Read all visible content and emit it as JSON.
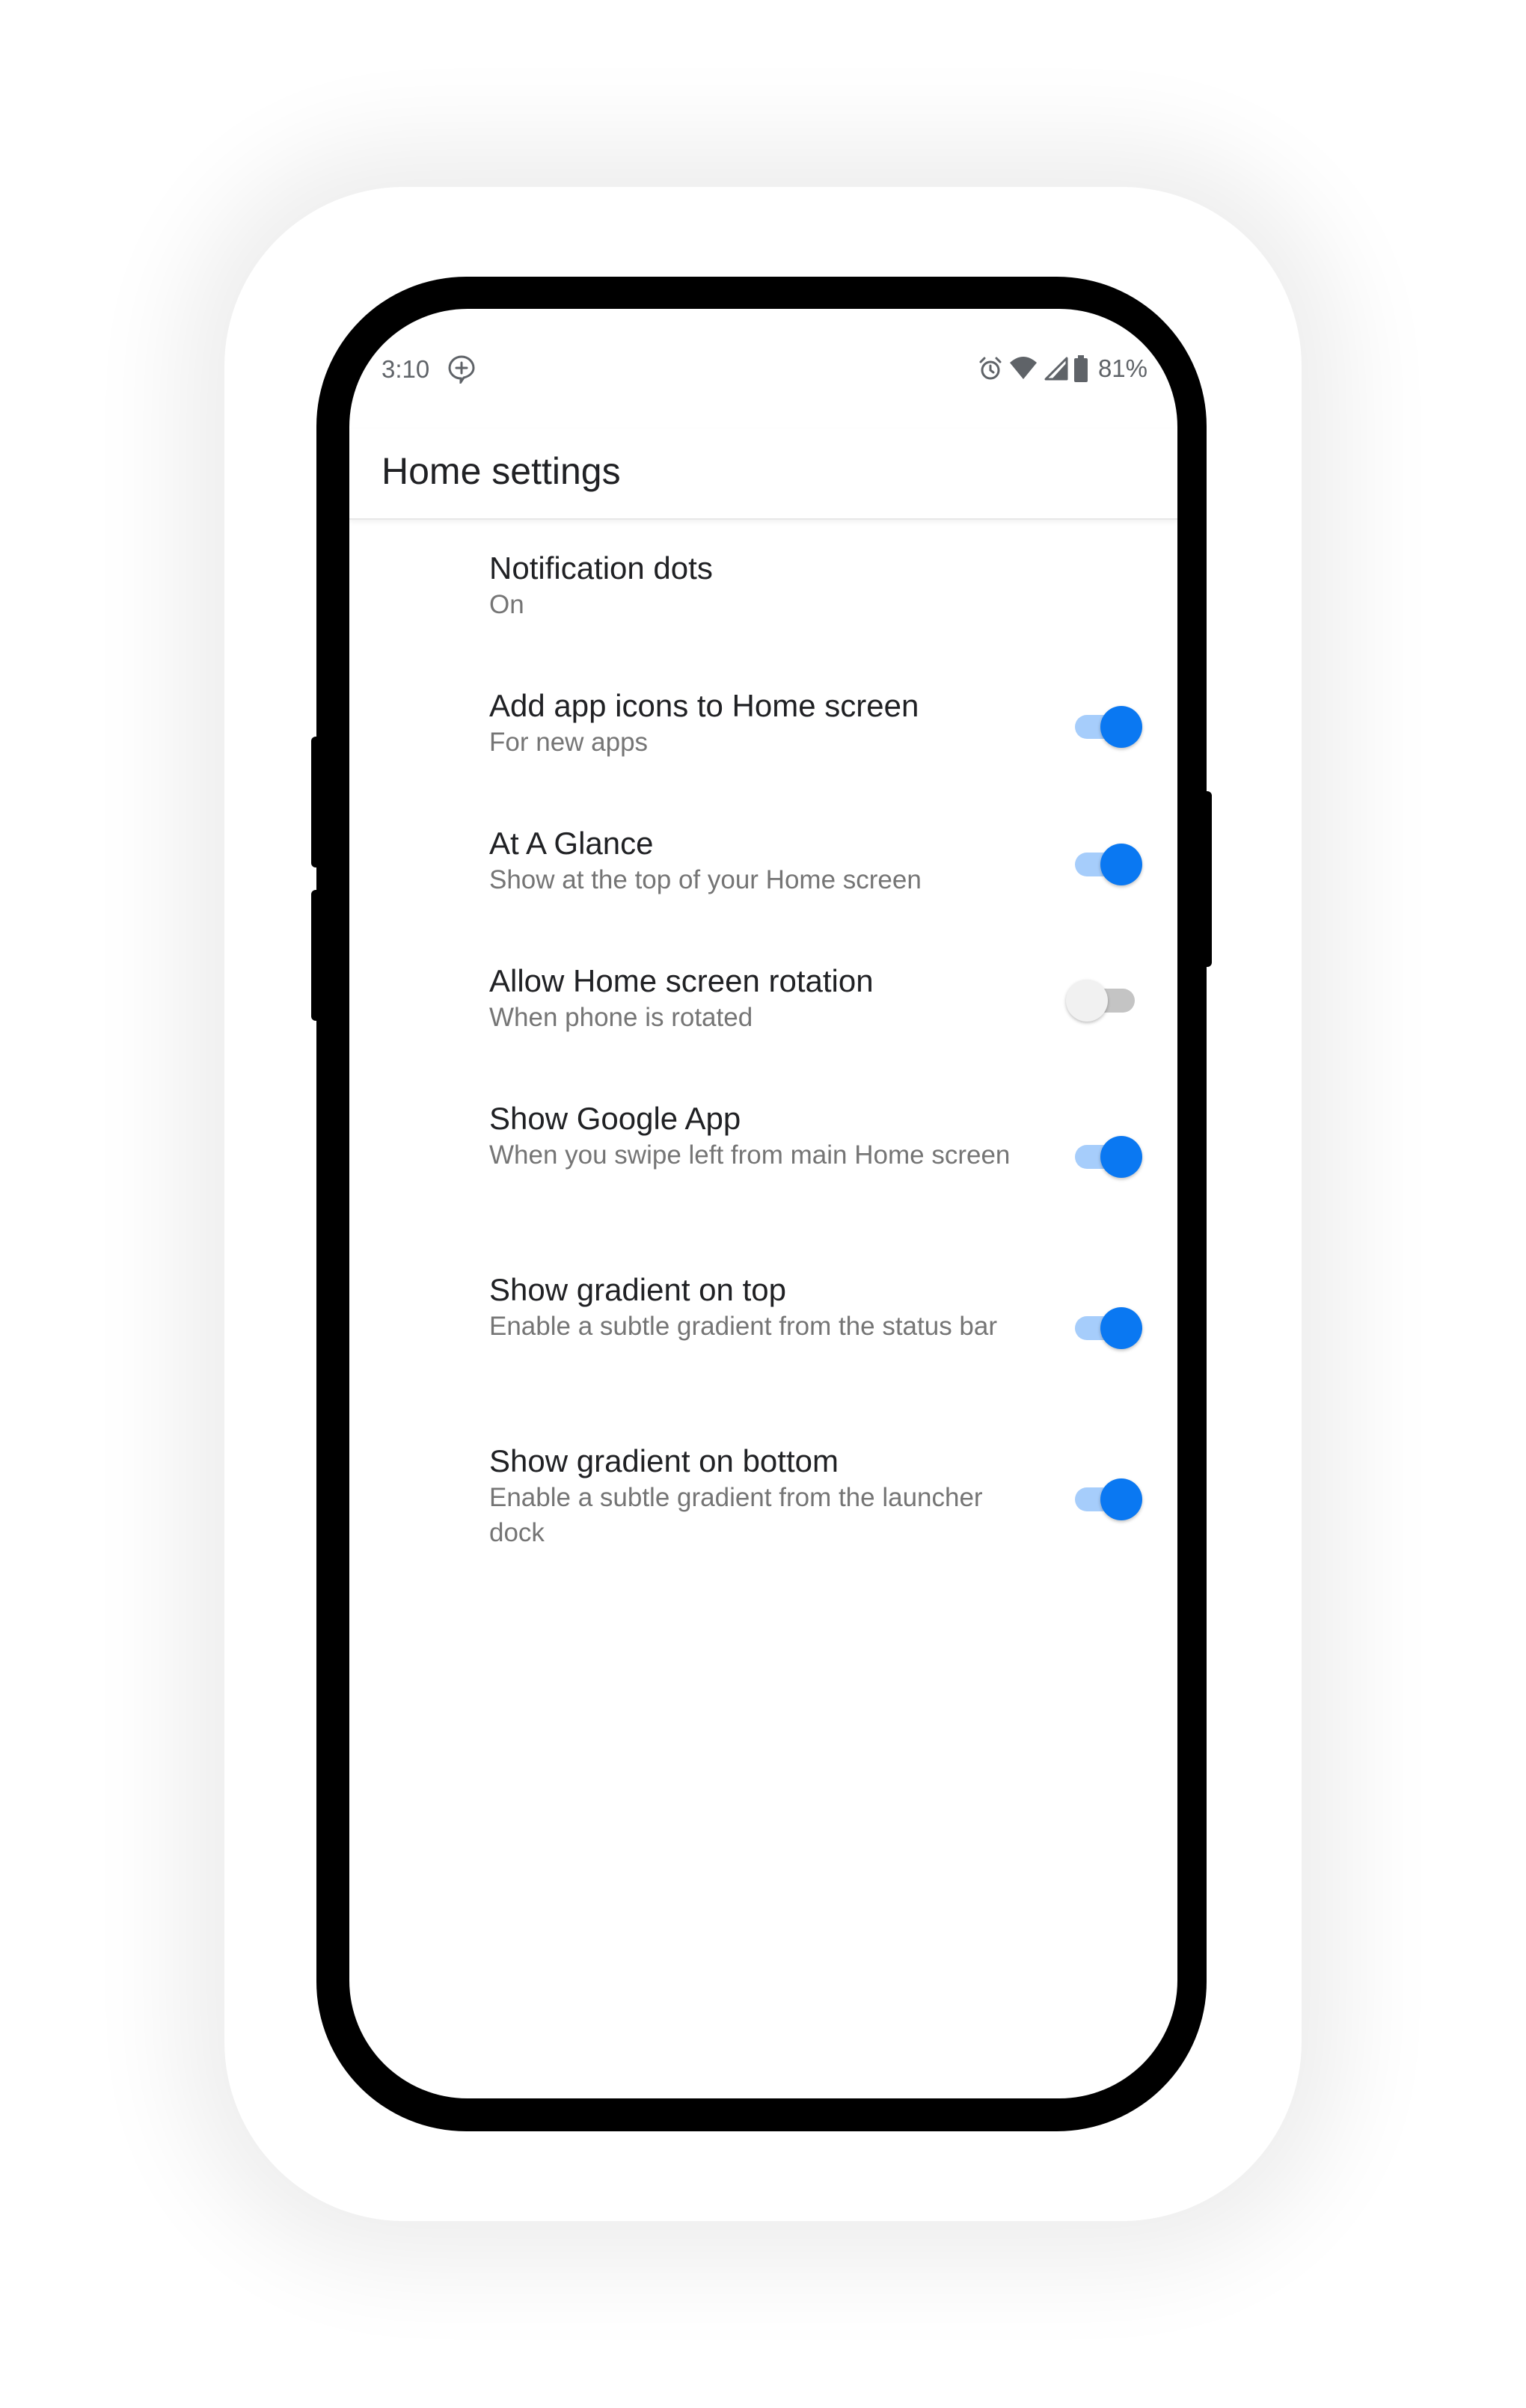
{
  "status_bar": {
    "time": "3:10",
    "left_icon": "assistant-plus-icon",
    "right_icons": [
      "alarm-icon",
      "wifi-icon",
      "cell-signal-icon",
      "battery-icon"
    ],
    "battery_percent": "81%"
  },
  "app_bar": {
    "title": "Home settings"
  },
  "settings": [
    {
      "title": "Notification dots",
      "subtitle": "On",
      "toggle": null
    },
    {
      "title": "Add app icons to Home screen",
      "subtitle": "For new apps",
      "toggle": true
    },
    {
      "title": "At A Glance",
      "subtitle": "Show at the top of your Home screen",
      "toggle": true
    },
    {
      "title": "Allow Home screen rotation",
      "subtitle": "When phone is rotated",
      "toggle": false
    },
    {
      "title": "Show Google App",
      "subtitle": "When you swipe left from main Home screen",
      "toggle": true
    },
    {
      "title": "Show gradient on top",
      "subtitle": "Enable a subtle gradient from the status bar",
      "toggle": true
    },
    {
      "title": "Show gradient on bottom",
      "subtitle": "Enable a subtle gradient from the launcher dock",
      "toggle": true
    }
  ],
  "colors": {
    "accent": "#0a78f2",
    "accent_track": "#a6cdfb",
    "title_text": "#202124",
    "subtitle_text": "#757575",
    "frame": "#000000"
  }
}
